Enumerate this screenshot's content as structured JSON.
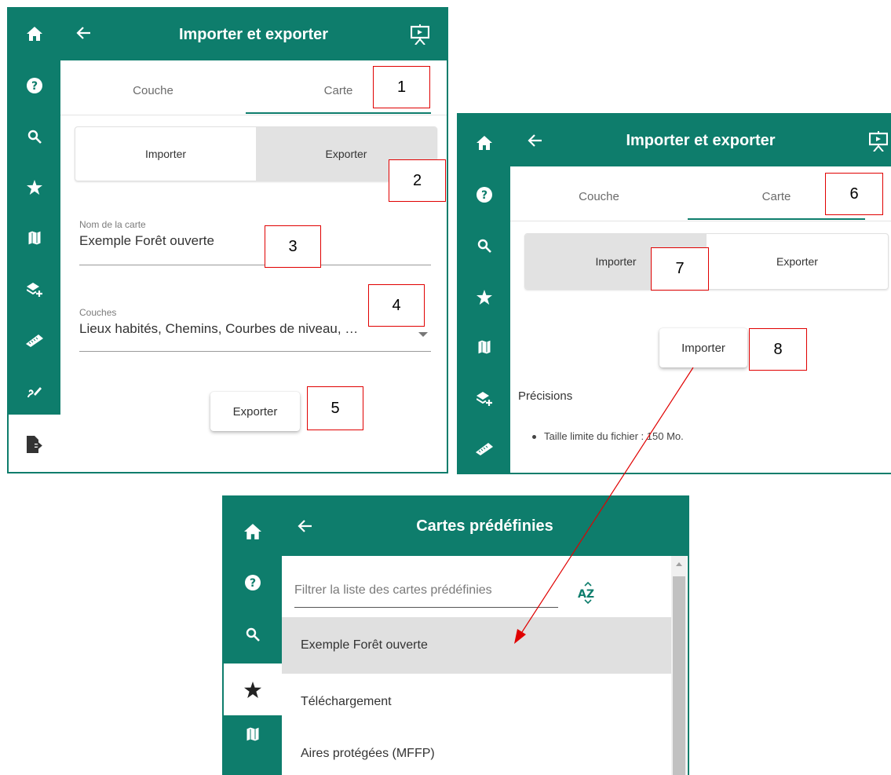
{
  "panel1": {
    "header_title": "Importer et exporter",
    "tabs": [
      {
        "label": "Couche"
      },
      {
        "label": "Carte"
      }
    ],
    "segment": {
      "import_label": "Importer",
      "export_label": "Exporter",
      "selected": "Exporter"
    },
    "map_name": {
      "label": "Nom de la carte",
      "value": "Exemple Forêt ouverte"
    },
    "layers": {
      "label": "Couches",
      "value": "Lieux habités, Chemins, Courbes de niveau, …"
    },
    "action_button": "Exporter"
  },
  "panel2": {
    "header_title": "Importer et exporter",
    "tabs": [
      {
        "label": "Couche"
      },
      {
        "label": "Carte"
      }
    ],
    "segment": {
      "import_label": "Importer",
      "export_label": "Exporter",
      "selected": "Importer"
    },
    "action_button": "Importer",
    "precisions_title": "Précisions",
    "precisions_items": [
      "Taille limite du fichier : 150 Mo."
    ]
  },
  "panel3": {
    "header_title": "Cartes prédéfinies",
    "filter_placeholder": "Filtrer la liste des cartes prédéfinies",
    "sort_icon": "sort-az-icon",
    "items": [
      "Exemple Forêt ouverte",
      "Téléchargement",
      "Aires protégées (MFFP)"
    ],
    "selected_item": "Exemple Forêt ouverte"
  },
  "callouts": [
    "1",
    "2",
    "3",
    "4",
    "5",
    "6",
    "7",
    "8"
  ],
  "colors": {
    "primary": "#0e7d6c",
    "annotation": "#e00000",
    "selected_bg": "#e0e0e0"
  }
}
